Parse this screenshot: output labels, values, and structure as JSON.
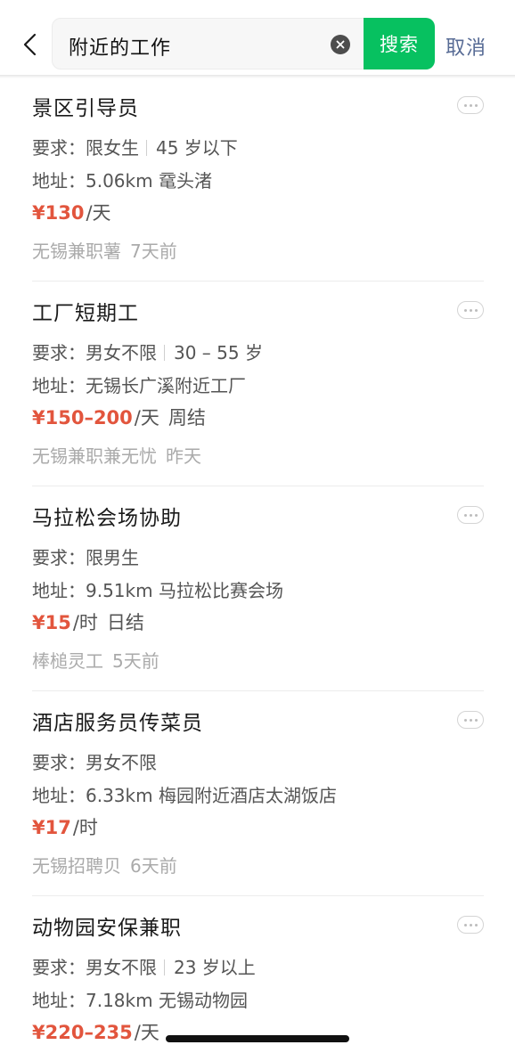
{
  "search": {
    "query": "附近的工作",
    "button_label": "搜索",
    "cancel_label": "取消"
  },
  "icons": {
    "back": "chevron-left-icon",
    "clear": "clear-icon",
    "more": "more-dots-icon"
  },
  "colors": {
    "accent_green": "#07c160",
    "salary_red": "#e2553d",
    "cancel_blue": "#576b95"
  },
  "jobs": [
    {
      "title": "景区引导员",
      "req_prefix": "要求：",
      "req_main": "限女生",
      "req_extra": "45 岁以下",
      "addr_prefix": "地址：",
      "addr": "5.06km 鼋头渚",
      "price": "¥130",
      "unit": "/天",
      "extra": "",
      "source": "无锡兼职薯",
      "time": "7天前"
    },
    {
      "title": "工厂短期工",
      "req_prefix": "要求：",
      "req_main": "男女不限",
      "req_extra": "30 – 55 岁",
      "addr_prefix": "地址：",
      "addr": "无锡长广溪附近工厂",
      "price": "¥150–200",
      "unit": "/天",
      "extra": "周结",
      "source": "无锡兼职兼无忧",
      "time": "昨天"
    },
    {
      "title": "马拉松会场协助",
      "req_prefix": "要求：",
      "req_main": "限男生",
      "req_extra": "",
      "addr_prefix": "地址：",
      "addr": "9.51km 马拉松比赛会场",
      "price": "¥15",
      "unit": "/时",
      "extra": "日结",
      "source": "棒槌灵工",
      "time": "5天前"
    },
    {
      "title": "酒店服务员传菜员",
      "req_prefix": "要求：",
      "req_main": "男女不限",
      "req_extra": "",
      "addr_prefix": "地址：",
      "addr": "6.33km 梅园附近酒店太湖饭店",
      "price": "¥17",
      "unit": "/时",
      "extra": "",
      "source": "无锡招聘贝",
      "time": "6天前"
    },
    {
      "title": "动物园安保兼职",
      "req_prefix": "要求：",
      "req_main": "男女不限",
      "req_extra": "23 岁以上",
      "addr_prefix": "地址：",
      "addr": "7.18km 无锡动物园",
      "price": "¥220–235",
      "unit": "/天",
      "extra": "",
      "source": "",
      "time": ""
    }
  ]
}
